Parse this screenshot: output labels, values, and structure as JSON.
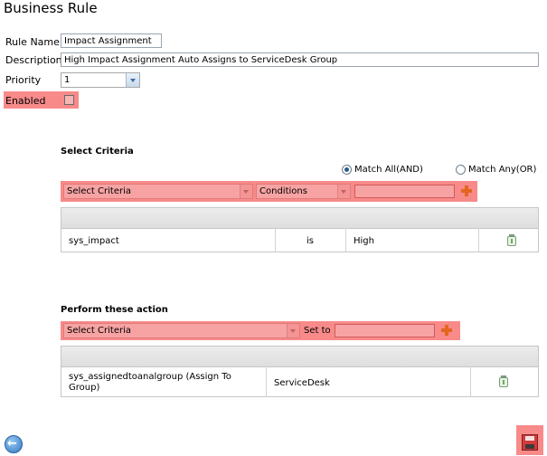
{
  "page": {
    "title": "Business Rule"
  },
  "form": {
    "rule_name_label": "Rule Name",
    "rule_name_value": "Impact Assignment",
    "description_label": "Description",
    "description_value": "High Impact Assignment Auto Assigns to ServiceDesk Group",
    "priority_label": "Priority",
    "priority_value": "1",
    "enabled_label": "Enabled",
    "enabled_checked": false
  },
  "criteria": {
    "title": "Select Criteria",
    "match_all_label": "Match All(AND)",
    "match_any_label": "Match Any(OR)",
    "match_mode": "all",
    "field_select": "Select Criteria",
    "condition_select": "Conditions",
    "value": "",
    "rows": [
      {
        "field": "sys_impact",
        "operator": "is",
        "value": "High"
      }
    ]
  },
  "actions": {
    "title": "Perform these action",
    "field_select": "Select Criteria",
    "set_to_label": "Set to",
    "value": "",
    "rows": [
      {
        "field": "sys_assignedtoanalgroup (Assign To Group)",
        "value": "ServiceDesk"
      }
    ]
  },
  "colors": {
    "highlight": "#f88a8a",
    "plus_icon": "#e2661f",
    "save_icon": "#d13b3b",
    "back_icon": "#2f78c6"
  }
}
